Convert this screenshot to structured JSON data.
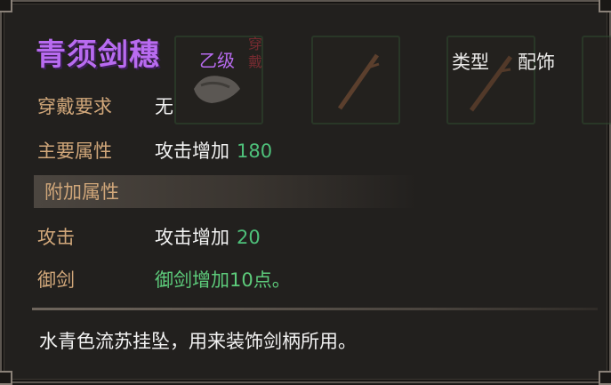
{
  "item": {
    "name": "青须剑穗",
    "grade": "乙级",
    "equipped_tag": "穿戴",
    "type_label": "类型",
    "type_value": "配饰"
  },
  "requirements": {
    "label": "穿戴要求",
    "value": "无"
  },
  "main_attr": {
    "label": "主要属性",
    "text": "攻击增加",
    "number": "180"
  },
  "extra_section": {
    "title": "附加属性"
  },
  "extra_attrs": [
    {
      "label": "攻击",
      "text": "攻击增加",
      "number": "20"
    },
    {
      "label": "御剑",
      "text": "御剑增加10点。"
    }
  ],
  "description": "水青色流苏挂坠，用来装饰剑柄所用。",
  "colors": {
    "name": "#b86bf0",
    "label": "#d1a77a",
    "value": "#f2f2f2",
    "number_green": "#4ec07a"
  }
}
